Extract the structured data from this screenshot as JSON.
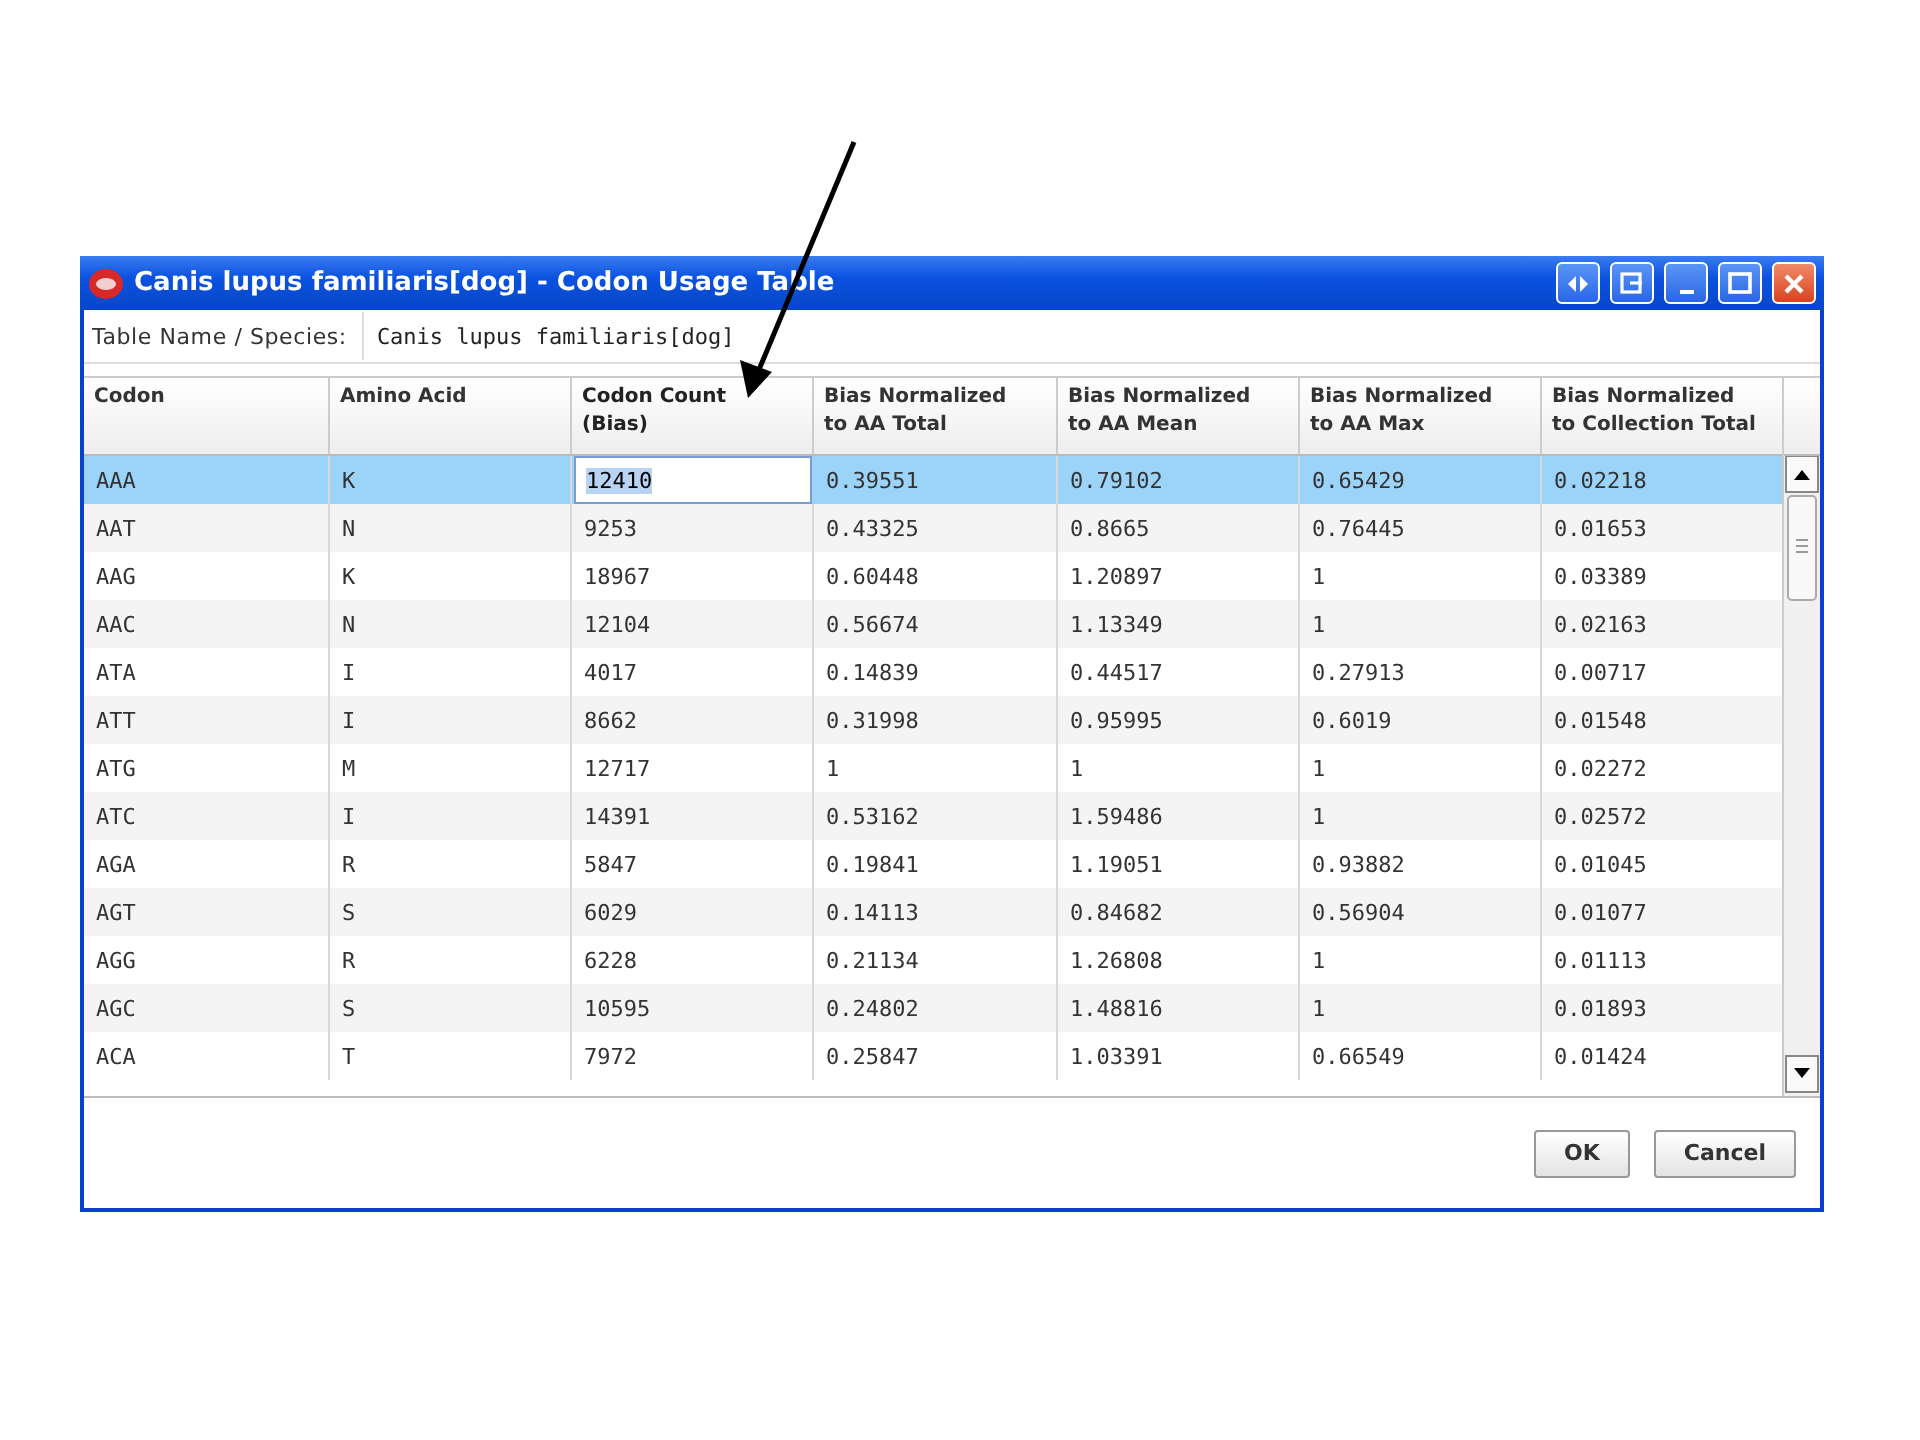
{
  "window": {
    "title": "Canis lupus familiaris[dog] - Codon Usage Table"
  },
  "table_name": {
    "label": "Table Name / Species:",
    "value": "Canis lupus familiaris[dog]"
  },
  "table": {
    "columns": [
      {
        "label": "Codon",
        "editable": false
      },
      {
        "label": "Amino Acid",
        "editable": false
      },
      {
        "label": "Codon Count (Bias)",
        "editable": true
      },
      {
        "label": "Bias Normalized to AA Total",
        "editable": false
      },
      {
        "label": "Bias Normalized to AA Mean",
        "editable": false
      },
      {
        "label": "Bias Normalized to AA Max",
        "editable": false
      },
      {
        "label": "Bias Normalized to Collection Total",
        "editable": false
      }
    ],
    "rows": [
      {
        "selected": true,
        "editing": true,
        "cells": [
          "AAA",
          "K",
          "12410",
          "0.39551",
          "0.79102",
          "0.65429",
          "0.02218"
        ]
      },
      {
        "selected": false,
        "editing": false,
        "cells": [
          "AAT",
          "N",
          "9253",
          "0.43325",
          "0.8665",
          "0.76445",
          "0.01653"
        ]
      },
      {
        "selected": false,
        "editing": false,
        "cells": [
          "AAG",
          "K",
          "18967",
          "0.60448",
          "1.20897",
          "1",
          "0.03389"
        ]
      },
      {
        "selected": false,
        "editing": false,
        "cells": [
          "AAC",
          "N",
          "12104",
          "0.56674",
          "1.13349",
          "1",
          "0.02163"
        ]
      },
      {
        "selected": false,
        "editing": false,
        "cells": [
          "ATA",
          "I",
          "4017",
          "0.14839",
          "0.44517",
          "0.27913",
          "0.00717"
        ]
      },
      {
        "selected": false,
        "editing": false,
        "cells": [
          "ATT",
          "I",
          "8662",
          "0.31998",
          "0.95995",
          "0.6019",
          "0.01548"
        ]
      },
      {
        "selected": false,
        "editing": false,
        "cells": [
          "ATG",
          "M",
          "12717",
          "1",
          "1",
          "1",
          "0.02272"
        ]
      },
      {
        "selected": false,
        "editing": false,
        "cells": [
          "ATC",
          "I",
          "14391",
          "0.53162",
          "1.59486",
          "1",
          "0.02572"
        ]
      },
      {
        "selected": false,
        "editing": false,
        "cells": [
          "AGA",
          "R",
          "5847",
          "0.19841",
          "1.19051",
          "0.93882",
          "0.01045"
        ]
      },
      {
        "selected": false,
        "editing": false,
        "cells": [
          "AGT",
          "S",
          "6029",
          "0.14113",
          "0.84682",
          "0.56904",
          "0.01077"
        ]
      },
      {
        "selected": false,
        "editing": false,
        "cells": [
          "AGG",
          "R",
          "6228",
          "0.21134",
          "1.26808",
          "1",
          "0.01113"
        ]
      },
      {
        "selected": false,
        "editing": false,
        "cells": [
          "AGC",
          "S",
          "10595",
          "0.24802",
          "1.48816",
          "1",
          "0.01893"
        ]
      },
      {
        "selected": false,
        "editing": false,
        "cells": [
          "ACA",
          "T",
          "7972",
          "0.25847",
          "1.03391",
          "0.66549",
          "0.01424"
        ]
      }
    ]
  },
  "buttons": [
    "OK",
    "Cancel"
  ]
}
